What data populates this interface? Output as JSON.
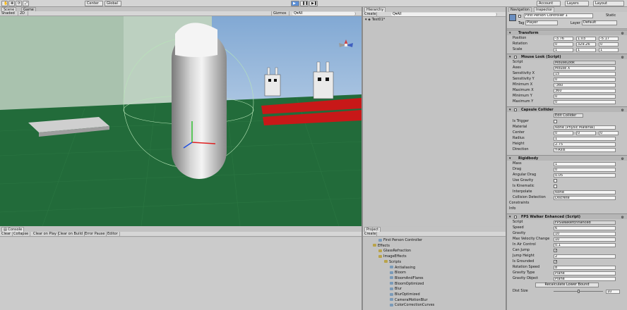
{
  "toolbar": {
    "transform_tools": [
      "✋",
      "✥",
      "⟳",
      "⤢"
    ],
    "pivot": "Center",
    "space": "Global",
    "play": "▶",
    "pause": "❚❚",
    "step": "▶❚",
    "collab": "Account",
    "layers": "Layers",
    "layout": "Layout"
  },
  "scene_tabs": [
    "Scene",
    "Game"
  ],
  "scene_bar": {
    "shading": "Shaded",
    "mode": "2D",
    "gizmos": "Gizmos",
    "search": "Q▾All"
  },
  "hierarchy": {
    "tab": "Hierarchy",
    "create": "Create",
    "search": "Q▾All",
    "scene": "Test01*"
  },
  "inspector": {
    "tabs": [
      "Navigation",
      "Inspector"
    ],
    "object_name": "First Person Controller 1",
    "static": "Static",
    "tag_label": "Tag",
    "tag": "Player",
    "layer_label": "Layer",
    "layer": "Default",
    "transform": {
      "title": "Transform",
      "position_label": "Position",
      "position": [
        "-3.76",
        "1.03",
        "-5.17"
      ],
      "rotation_label": "Rotation",
      "rotation": [
        "0",
        "329.26",
        "0"
      ],
      "scale_label": "Scale",
      "scale": [
        "1",
        "1",
        "1"
      ]
    },
    "mouse_look": {
      "title": "Mouse Look (Script)",
      "rows": [
        {
          "label": "Script",
          "value": "MouseLook"
        },
        {
          "label": "Axes",
          "value": "Mouse X"
        },
        {
          "label": "Sensitivity X",
          "value": "15"
        },
        {
          "label": "Sensitivity Y",
          "value": "0"
        },
        {
          "label": "Minimum X",
          "value": "-360"
        },
        {
          "label": "Maximum X",
          "value": "360"
        },
        {
          "label": "Minimum Y",
          "value": "0"
        },
        {
          "label": "Maximum Y",
          "value": "0"
        }
      ]
    },
    "capsule": {
      "title": "Capsule Collider",
      "edit": "Edit Collider",
      "is_trigger": "Is Trigger",
      "material_label": "Material",
      "material": "None (Physic Material)",
      "center_label": "Center",
      "center": [
        "0",
        "0",
        "0"
      ],
      "radius_label": "Radius",
      "radius": "1",
      "height_label": "Height",
      "height": "2.75",
      "direction_label": "Direction",
      "direction": "Y-Axis"
    },
    "rigidbody": {
      "title": "Rigidbody",
      "mass_label": "Mass",
      "mass": "1",
      "drag_label": "Drag",
      "drag": "0",
      "angdrag_label": "Angular Drag",
      "angdrag": "0.05",
      "gravity_label": "Use Gravity",
      "kinematic_label": "Is Kinematic",
      "interp_label": "Interpolate",
      "interp": "None",
      "coll_label": "Collision Detection",
      "coll": "Discrete",
      "constraints": "Constraints",
      "info": "Info"
    },
    "fps": {
      "title": "FPS Walker Enhanced (Script)",
      "rows": [
        {
          "label": "Script",
          "value": "FPSWalkerEnhanced"
        },
        {
          "label": "Speed",
          "value": "6"
        },
        {
          "label": "Gravity",
          "value": "10"
        },
        {
          "label": "Max Velocity Change",
          "value": "10"
        },
        {
          "label": "In Air Control",
          "value": "0.1"
        }
      ],
      "can_jump": "Can Jump",
      "jump_label": "Jump Height",
      "jump": "2",
      "grounded": "Is Grounded",
      "rot_label": "Rotation Speed",
      "rot": "8",
      "gtype_label": "Gravity Type",
      "gtype": "Plane",
      "gobj_label": "Gravity Object",
      "gobj": "Plane",
      "recalc": "Recalculate Lower Bound",
      "dist_label": "Dist Size",
      "dist": "10"
    }
  },
  "console": {
    "tab": "Console",
    "buttons": [
      "Clear",
      "Collapse",
      "Clear on Play",
      "Clear on Build",
      "Error Pause",
      "Editor"
    ]
  },
  "project": {
    "tab": "Project",
    "create": "Create",
    "items": [
      {
        "label": "First Person Controller",
        "level": 1,
        "folder": false
      },
      {
        "label": "Effects",
        "level": 0,
        "folder": true
      },
      {
        "label": "GlassRefraction",
        "level": 1,
        "folder": true
      },
      {
        "label": "ImageEffects",
        "level": 1,
        "folder": true
      },
      {
        "label": "Scripts",
        "level": 2,
        "folder": true
      },
      {
        "label": "Antialiasing",
        "level": 3,
        "folder": false
      },
      {
        "label": "Bloom",
        "level": 3,
        "folder": false
      },
      {
        "label": "BloomAndFlares",
        "level": 3,
        "folder": false
      },
      {
        "label": "BloomOptimized",
        "level": 3,
        "folder": false
      },
      {
        "label": "Blur",
        "level": 3,
        "folder": false
      },
      {
        "label": "BlurOptimized",
        "level": 3,
        "folder": false
      },
      {
        "label": "CameraMotionBlur",
        "level": 3,
        "folder": false
      },
      {
        "label": "ColorCorrectionCurves",
        "level": 3,
        "folder": false
      }
    ]
  }
}
